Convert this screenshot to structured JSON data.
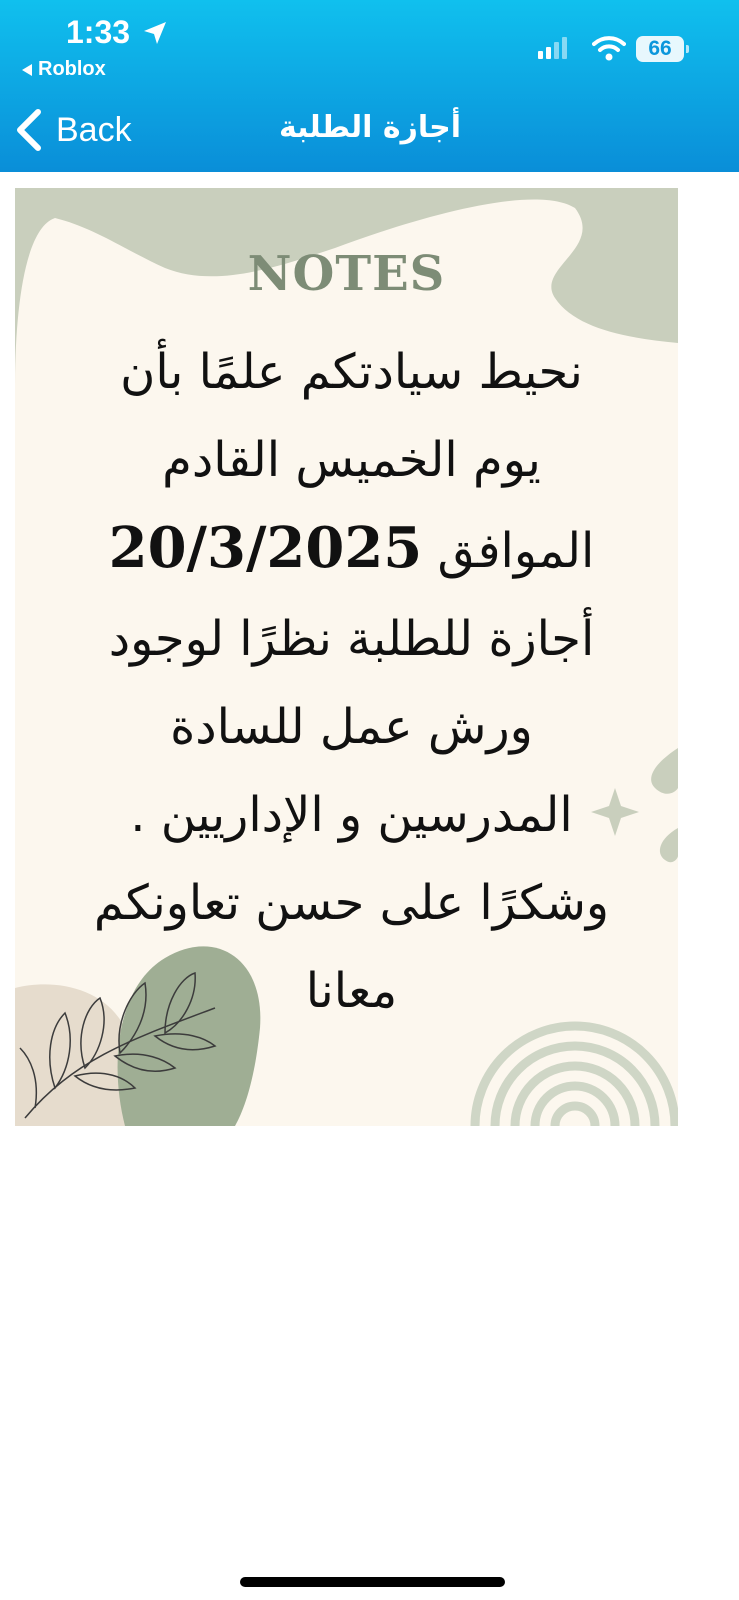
{
  "status_bar": {
    "time": "1:33",
    "back_app": "Roblox",
    "battery": "66"
  },
  "nav": {
    "back_label": "Back",
    "title": "أجازة الطلبة"
  },
  "note": {
    "heading": "NOTES",
    "line1": "نحيط سيادتكم علمًا بأن",
    "line2": "يوم الخميس القادم",
    "line3_prefix": "الموافق",
    "date": "20/3/2025",
    "line4": "أجازة للطلبة نظرًا لوجود",
    "line5": "ورش عمل للسادة",
    "line6": "المدرسين و الإداريين .",
    "line7": "وشكرًا على حسن تعاونكم",
    "line8": "معانا"
  },
  "colors": {
    "header_top": "#10c0ee",
    "header_bottom": "#0a8ed8",
    "card_bg": "#fcf7ee",
    "sage": "#c9cfbd",
    "heading": "#7d8c76"
  }
}
